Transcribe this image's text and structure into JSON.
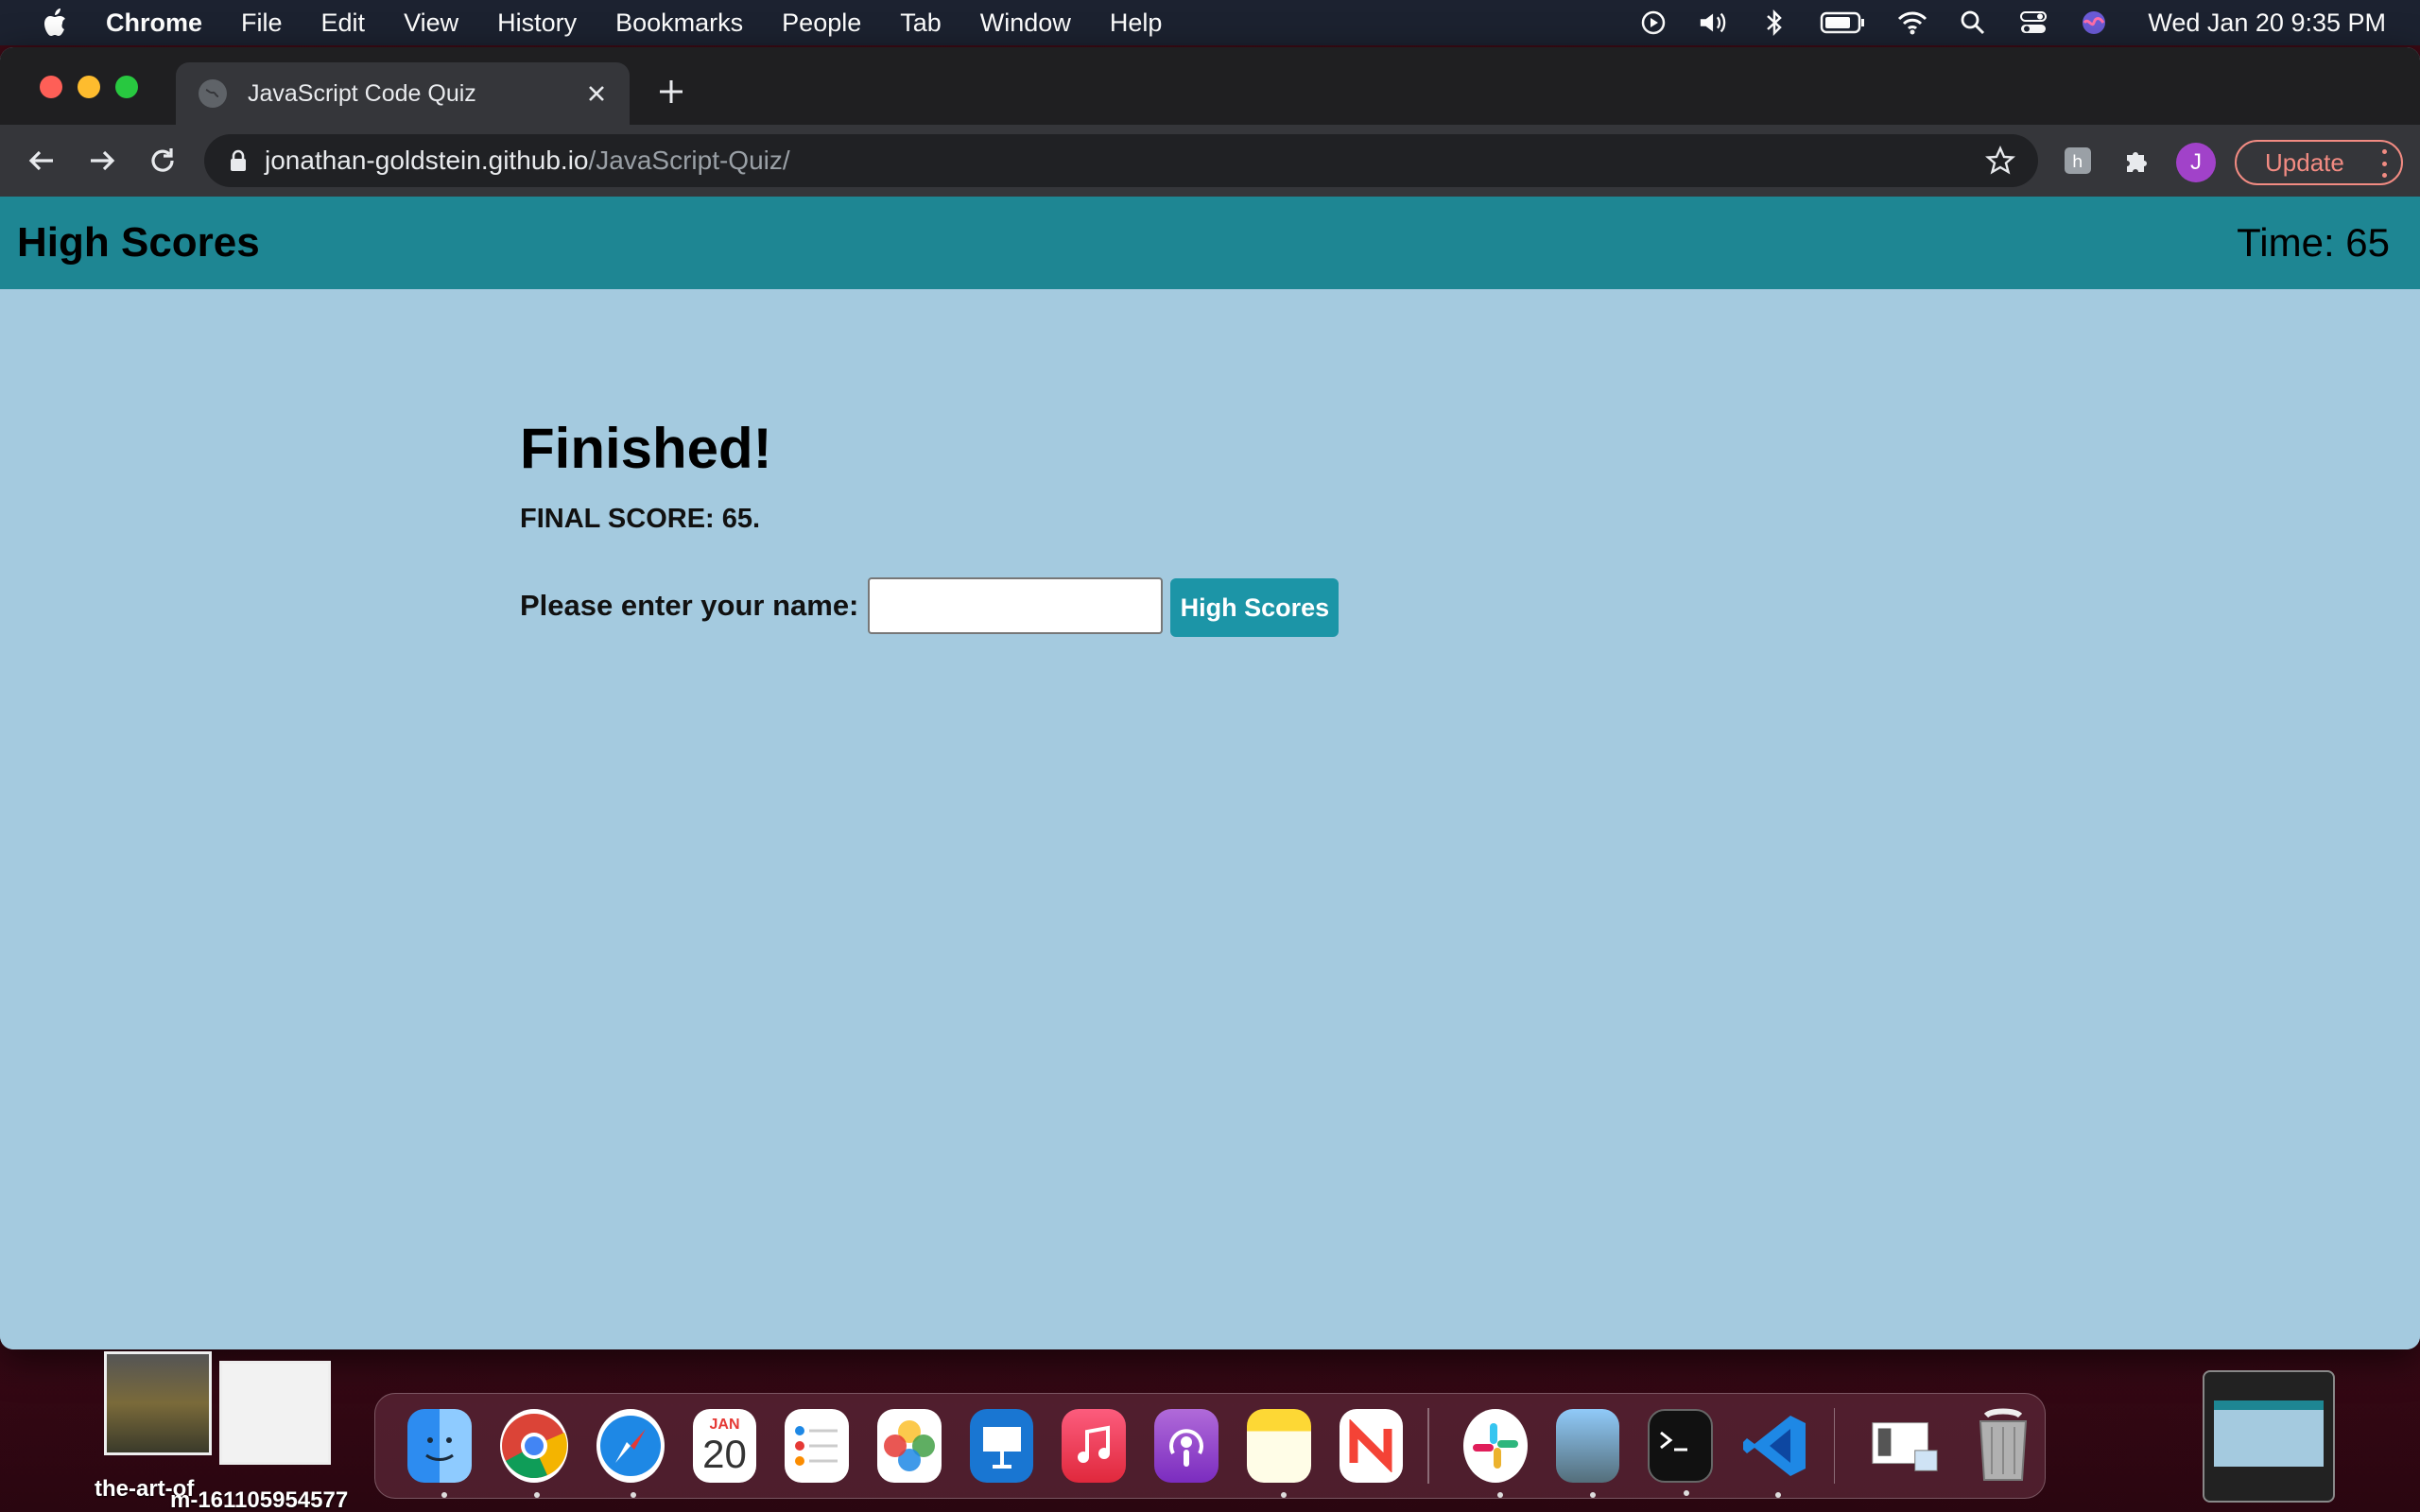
{
  "menubar": {
    "app_name": "Chrome",
    "items": [
      "File",
      "Edit",
      "View",
      "History",
      "Bookmarks",
      "People",
      "Tab",
      "Window",
      "Help"
    ],
    "clock": "Wed Jan 20  9:35 PM",
    "status_icons": [
      "play-icon",
      "volume-icon",
      "bluetooth-icon",
      "battery-icon",
      "wifi-icon",
      "spotlight-icon",
      "control-center-icon",
      "siri-icon"
    ]
  },
  "browser": {
    "tab_title": "JavaScript Code Quiz",
    "url_host": "jonathan-goldstein.github.io",
    "url_path": "/JavaScript-Quiz/",
    "profile_initial": "J",
    "update_label": "Update"
  },
  "page": {
    "header_link": "High Scores",
    "timer": "Time: 65",
    "heading": "Finished!",
    "final_score": "FINAL SCORE: 65.",
    "name_label": "Please enter your name:",
    "name_value": "",
    "submit_label": "High Scores",
    "colors": {
      "header_bg": "#1e8693",
      "page_bg": "#a4cadf",
      "button_bg": "#1c95a7"
    }
  },
  "dock": {
    "calendar_month": "JAN",
    "calendar_day": "20",
    "apps": [
      "finder",
      "chrome",
      "safari",
      "calendar",
      "reminders",
      "photos",
      "keynote",
      "music",
      "podcasts",
      "notes",
      "news",
      "slack",
      "preview",
      "terminal",
      "vscode",
      "screenshot",
      "trash"
    ]
  },
  "desktop": {
    "file_label_1": "the-art-of",
    "file_label_2": "m-161105954577"
  }
}
